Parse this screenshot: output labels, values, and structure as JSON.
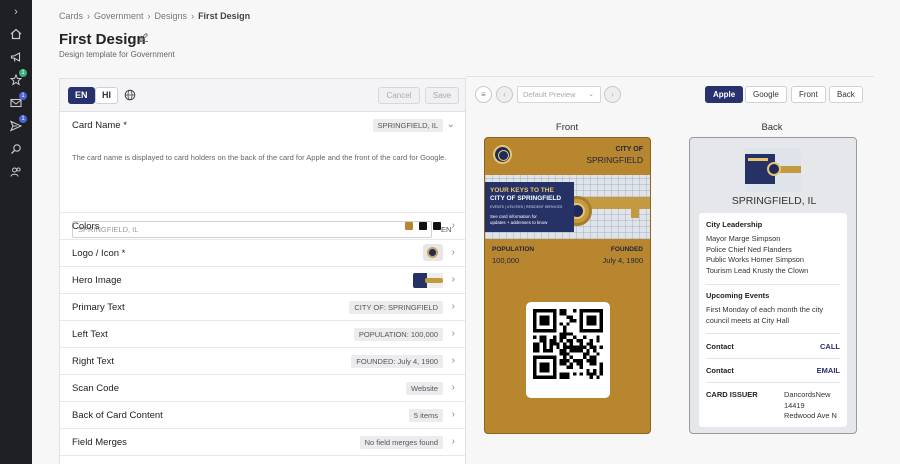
{
  "breadcrumb": [
    "Cards",
    "Government",
    "Designs",
    "First Design"
  ],
  "page": {
    "title": "First Design",
    "subtitle": "Design template for Government"
  },
  "rail": {
    "icons": [
      "chevron-right-icon",
      "home-icon",
      "megaphone-icon",
      "star-icon",
      "mail-icon",
      "send-icon",
      "search-icon",
      "users-icon"
    ],
    "badges": {
      "star": "1",
      "mail": "1",
      "send": "1"
    }
  },
  "toolbar": {
    "lang_en": "EN",
    "lang_hi": "HI",
    "cancel": "Cancel",
    "save": "Save"
  },
  "card_name": {
    "label": "Card Name *",
    "value": "SPRINGFIELD, IL",
    "help": "The card name is displayed to card holders on the back of the card for Apple and the front of the card for Google.",
    "input_value": "SPRINGFIELD, IL",
    "input_lang": "EN"
  },
  "rows": {
    "colors": {
      "label": "Colors",
      "swatches": [
        "#b7862e",
        "#111111",
        "#111111"
      ]
    },
    "logo": {
      "label": "Logo / Icon *"
    },
    "hero": {
      "label": "Hero Image"
    },
    "primary": {
      "label": "Primary Text",
      "value": "CITY OF: SPRINGFIELD"
    },
    "left": {
      "label": "Left Text",
      "value": "POPULATION: 100,000"
    },
    "right": {
      "label": "Right Text",
      "value": "FOUNDED: July 4, 1900"
    },
    "scan": {
      "label": "Scan Code",
      "value": "Website"
    },
    "back": {
      "label": "Back of Card Content",
      "value": "5 items"
    },
    "merges": {
      "label": "Field Merges",
      "value": "No field merges found"
    }
  },
  "preview": {
    "select": "Default Preview",
    "platforms": [
      "Apple",
      "Google",
      "Front",
      "Back"
    ],
    "front_label": "Front",
    "back_label": "Back"
  },
  "front_card": {
    "primary_label": "CITY OF",
    "primary_value": "SPRINGFIELD",
    "hero_line1": "YOUR KEYS TO THE",
    "hero_line2": "CITY OF SPRINGFIELD",
    "hero_line3": "EVENTS | UTILITIES | RESIDENT SERVICES",
    "hero_line4": "See card information for updates + addresses to know",
    "left_label": "POPULATION",
    "left_value": "100,000",
    "right_label": "FOUNDED",
    "right_value": "July 4, 1900",
    "colors": {
      "background": "#b7862e",
      "hero_panel": "#263266"
    }
  },
  "back_card": {
    "name": "SPRINGFIELD, IL",
    "leadership_title": "City Leadership",
    "leadership_text": "Mayor Marge Simpson\nPolice Chief Ned Flanders\nPublic Works Homer Simpson\nTourism Lead Krusty the Clown",
    "events_title": "Upcoming Events",
    "events_text": "First Monday of each month the city council meets at City Hall",
    "contact1_label": "Contact",
    "contact1_value": "CALL",
    "contact2_label": "Contact",
    "contact2_value": "EMAIL",
    "issuer_label": "CARD ISSUER",
    "issuer_value": "DancordsNew\n14419\nRedwood Ave N"
  }
}
